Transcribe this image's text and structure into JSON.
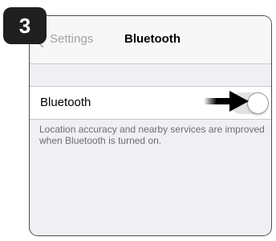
{
  "step_badge": "3",
  "navbar": {
    "back_label": "Settings",
    "title": "Bluetooth"
  },
  "bluetooth_cell": {
    "label": "Bluetooth",
    "toggle_state": "off"
  },
  "footer_note": "Location accuracy and nearby services are improved when Bluetooth is turned on.",
  "colors": {
    "badge_bg": "#1f1f1f",
    "background": "#efeff4",
    "back_text": "#a3a3a8",
    "note_text": "#6d6d72",
    "toggle_off": "#e2e2e2"
  },
  "icons": {
    "back": "chevron-left-icon",
    "pointer": "arrow-right-icon"
  }
}
